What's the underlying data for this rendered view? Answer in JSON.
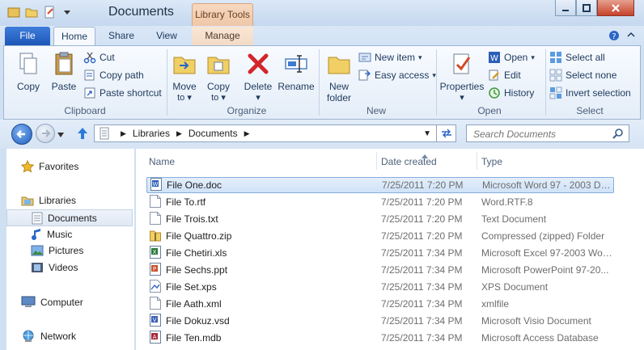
{
  "window": {
    "title": "Documents",
    "context_tab": "Library Tools"
  },
  "tabs": [
    "File",
    "Home",
    "Share",
    "View",
    "Manage"
  ],
  "ribbon": {
    "clipboard": {
      "label": "Clipboard",
      "copy": "Copy",
      "paste": "Paste",
      "cut": "Cut",
      "copy_path": "Copy path",
      "paste_shortcut": "Paste shortcut"
    },
    "organize": {
      "label": "Organize",
      "move_to_1": "Move",
      "move_to_2": "to",
      "copy_to_1": "Copy",
      "copy_to_2": "to",
      "delete": "Delete",
      "rename": "Rename"
    },
    "new": {
      "label": "New",
      "new_folder_1": "New",
      "new_folder_2": "folder",
      "new_item": "New item",
      "easy_access": "Easy access"
    },
    "open": {
      "label": "Open",
      "properties": "Properties",
      "open": "Open",
      "edit": "Edit",
      "history": "History"
    },
    "select": {
      "label": "Select",
      "select_all": "Select all",
      "select_none": "Select none",
      "invert_selection": "Invert selection"
    }
  },
  "address": {
    "crumbs": [
      "Libraries",
      "Documents"
    ]
  },
  "search": {
    "placeholder": "Search Documents"
  },
  "nav": {
    "favorites": "Favorites",
    "libraries": "Libraries",
    "documents": "Documents",
    "music": "Music",
    "pictures": "Pictures",
    "videos": "Videos",
    "computer": "Computer",
    "network": "Network"
  },
  "columns": {
    "name": "Name",
    "date": "Date created",
    "type": "Type"
  },
  "files": [
    {
      "name": "File One.doc",
      "date": "7/25/2011 7:20 PM",
      "type": "Microsoft Word 97 - 2003 Do...",
      "icon": "word-icon"
    },
    {
      "name": "File To.rtf",
      "date": "7/25/2011 7:20 PM",
      "type": "Word.RTF.8",
      "icon": "document-icon"
    },
    {
      "name": "File Trois.txt",
      "date": "7/25/2011 7:20 PM",
      "type": "Text Document",
      "icon": "document-icon"
    },
    {
      "name": "File Quattro.zip",
      "date": "7/25/2011 7:20 PM",
      "type": "Compressed (zipped) Folder",
      "icon": "zip-icon"
    },
    {
      "name": "File Chetiri.xls",
      "date": "7/25/2011 7:34 PM",
      "type": "Microsoft Excel 97-2003 Wor...",
      "icon": "excel-icon"
    },
    {
      "name": "File Sechs.ppt",
      "date": "7/25/2011 7:34 PM",
      "type": "Microsoft PowerPoint 97-20...",
      "icon": "powerpoint-icon"
    },
    {
      "name": "File Set.xps",
      "date": "7/25/2011 7:34 PM",
      "type": "XPS Document",
      "icon": "xps-icon"
    },
    {
      "name": "File Aath.xml",
      "date": "7/25/2011 7:34 PM",
      "type": "xmlfile",
      "icon": "document-icon"
    },
    {
      "name": "File Dokuz.vsd",
      "date": "7/25/2011 7:34 PM",
      "type": "Microsoft Visio Document",
      "icon": "visio-icon"
    },
    {
      "name": "File Ten.mdb",
      "date": "7/25/2011 7:34 PM",
      "type": "Microsoft Access Database",
      "icon": "access-icon"
    }
  ]
}
